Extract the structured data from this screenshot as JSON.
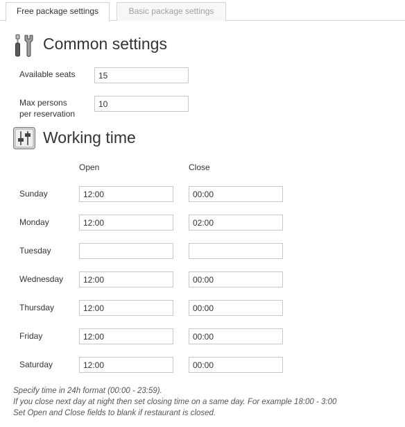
{
  "tabs": [
    {
      "label": "Free package settings",
      "active": true
    },
    {
      "label": "Basic package settings",
      "active": false
    }
  ],
  "common": {
    "title": "Common settings",
    "icon": "tools-icon",
    "available_seats_label": "Available seats",
    "available_seats_value": "15",
    "max_persons_label_line1": "Max persons",
    "max_persons_label_line2": "per reservation",
    "max_persons_value": "10"
  },
  "working": {
    "title": "Working time",
    "icon": "sliders-icon",
    "open_header": "Open",
    "close_header": "Close",
    "days": [
      {
        "name": "Sunday",
        "open": "12:00",
        "close": "00:00"
      },
      {
        "name": "Monday",
        "open": "12:00",
        "close": "02:00"
      },
      {
        "name": "Tuesday",
        "open": "",
        "close": ""
      },
      {
        "name": "Wednesday",
        "open": "12:00",
        "close": "00:00"
      },
      {
        "name": "Thursday",
        "open": "12:00",
        "close": "00:00"
      },
      {
        "name": "Friday",
        "open": "12:00",
        "close": "00:00"
      },
      {
        "name": "Saturday",
        "open": "12:00",
        "close": "00:00"
      }
    ]
  },
  "notes": [
    "Specify time in 24h format (00:00 - 23:59).",
    "If you close next day at night then set closing time on a same day. For example 18:00 - 3:00",
    "Set Open and Close fields to blank if restaurant is closed."
  ],
  "colors": {
    "border": "#c8c8c8",
    "tab_inactive_text": "#a0a0a0",
    "text": "#333333"
  }
}
